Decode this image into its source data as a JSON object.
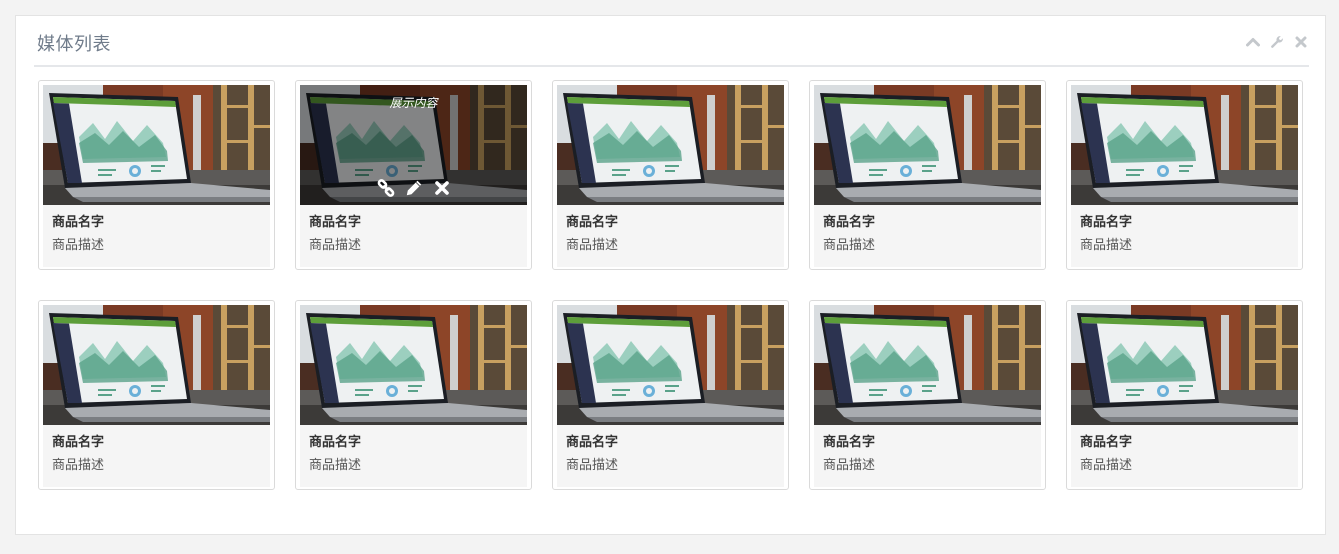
{
  "panel": {
    "title": "媒体列表",
    "tools": [
      "chevron-up-icon",
      "wrench-icon",
      "close-icon"
    ]
  },
  "overlay": {
    "text": "展示内容",
    "actions": [
      "link-icon",
      "pencil-icon",
      "close-icon"
    ]
  },
  "cards": [
    {
      "name": "商品名字",
      "desc": "商品描述"
    },
    {
      "name": "商品名字",
      "desc": "商品描述"
    },
    {
      "name": "商品名字",
      "desc": "商品描述"
    },
    {
      "name": "商品名字",
      "desc": "商品描述"
    },
    {
      "name": "商品名字",
      "desc": "商品描述"
    },
    {
      "name": "商品名字",
      "desc": "商品描述"
    },
    {
      "name": "商品名字",
      "desc": "商品描述"
    },
    {
      "name": "商品名字",
      "desc": "商品描述"
    },
    {
      "name": "商品名字",
      "desc": "商品描述"
    },
    {
      "name": "商品名字",
      "desc": "商品描述"
    }
  ],
  "colors": {
    "title": "#6f7b8a",
    "tool": "#c4c8cc"
  }
}
